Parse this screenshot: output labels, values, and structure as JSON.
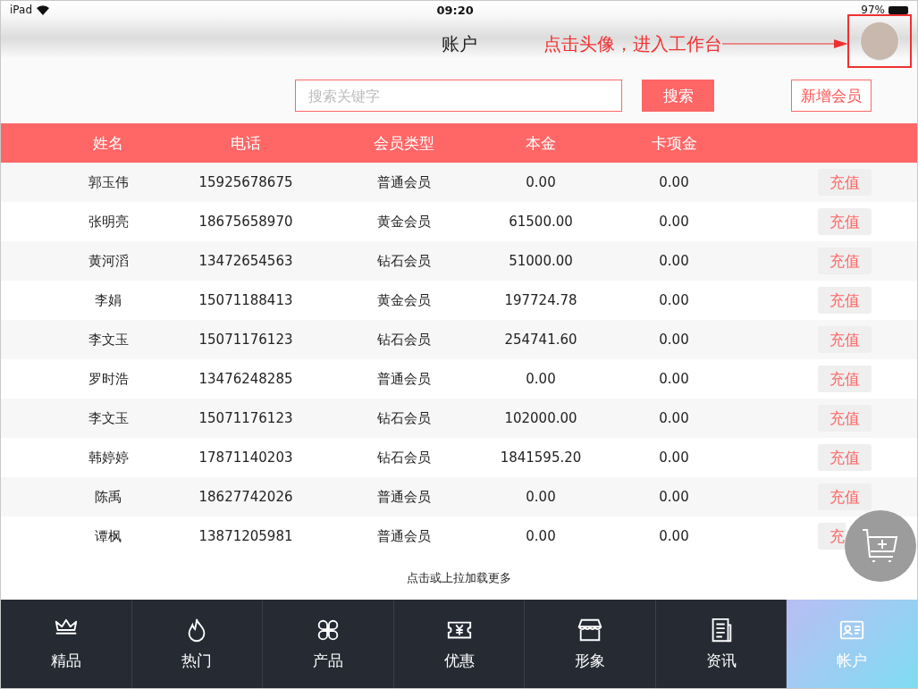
{
  "status_bar": {
    "device": "iPad",
    "time": "09:20",
    "battery": "97%"
  },
  "header": {
    "title": "账户",
    "annotation": "点击头像，进入工作台"
  },
  "search": {
    "placeholder": "搜索关键字",
    "button": "搜索",
    "add_button": "新增会员"
  },
  "table": {
    "columns": [
      "姓名",
      "电话",
      "会员类型",
      "本金",
      "卡项金"
    ],
    "rows": [
      {
        "name": "郭玉伟",
        "phone": "15925678675",
        "type": "普通会员",
        "principal": "0.00",
        "card": "0.00",
        "action": "充值"
      },
      {
        "name": "张明亮",
        "phone": "18675658970",
        "type": "黄金会员",
        "principal": "61500.00",
        "card": "0.00",
        "action": "充值"
      },
      {
        "name": "黄河滔",
        "phone": "13472654563",
        "type": "钻石会员",
        "principal": "51000.00",
        "card": "0.00",
        "action": "充值"
      },
      {
        "name": "李娟",
        "phone": "15071188413",
        "type": "黄金会员",
        "principal": "197724.78",
        "card": "0.00",
        "action": "充值"
      },
      {
        "name": "李文玉",
        "phone": "15071176123",
        "type": "钻石会员",
        "principal": "254741.60",
        "card": "0.00",
        "action": "充值"
      },
      {
        "name": "罗时浩",
        "phone": "13476248285",
        "type": "普通会员",
        "principal": "0.00",
        "card": "0.00",
        "action": "充值"
      },
      {
        "name": "李文玉",
        "phone": "15071176123",
        "type": "钻石会员",
        "principal": "102000.00",
        "card": "0.00",
        "action": "充值"
      },
      {
        "name": "韩婷婷",
        "phone": "17871140203",
        "type": "钻石会员",
        "principal": "1841595.20",
        "card": "0.00",
        "action": "充值"
      },
      {
        "name": "陈禹",
        "phone": "18627742026",
        "type": "普通会员",
        "principal": "0.00",
        "card": "0.00",
        "action": "充值"
      },
      {
        "name": "谭枫",
        "phone": "13871205981",
        "type": "普通会员",
        "principal": "0.00",
        "card": "0.00",
        "action": "充"
      }
    ],
    "load_more": "点击或上拉加载更多"
  },
  "tabs": [
    {
      "label": "精品",
      "selected": false
    },
    {
      "label": "热门",
      "selected": false
    },
    {
      "label": "产品",
      "selected": false
    },
    {
      "label": "优惠",
      "selected": false
    },
    {
      "label": "形象",
      "selected": false
    },
    {
      "label": "资讯",
      "selected": false
    },
    {
      "label": "帐户",
      "selected": true
    }
  ]
}
